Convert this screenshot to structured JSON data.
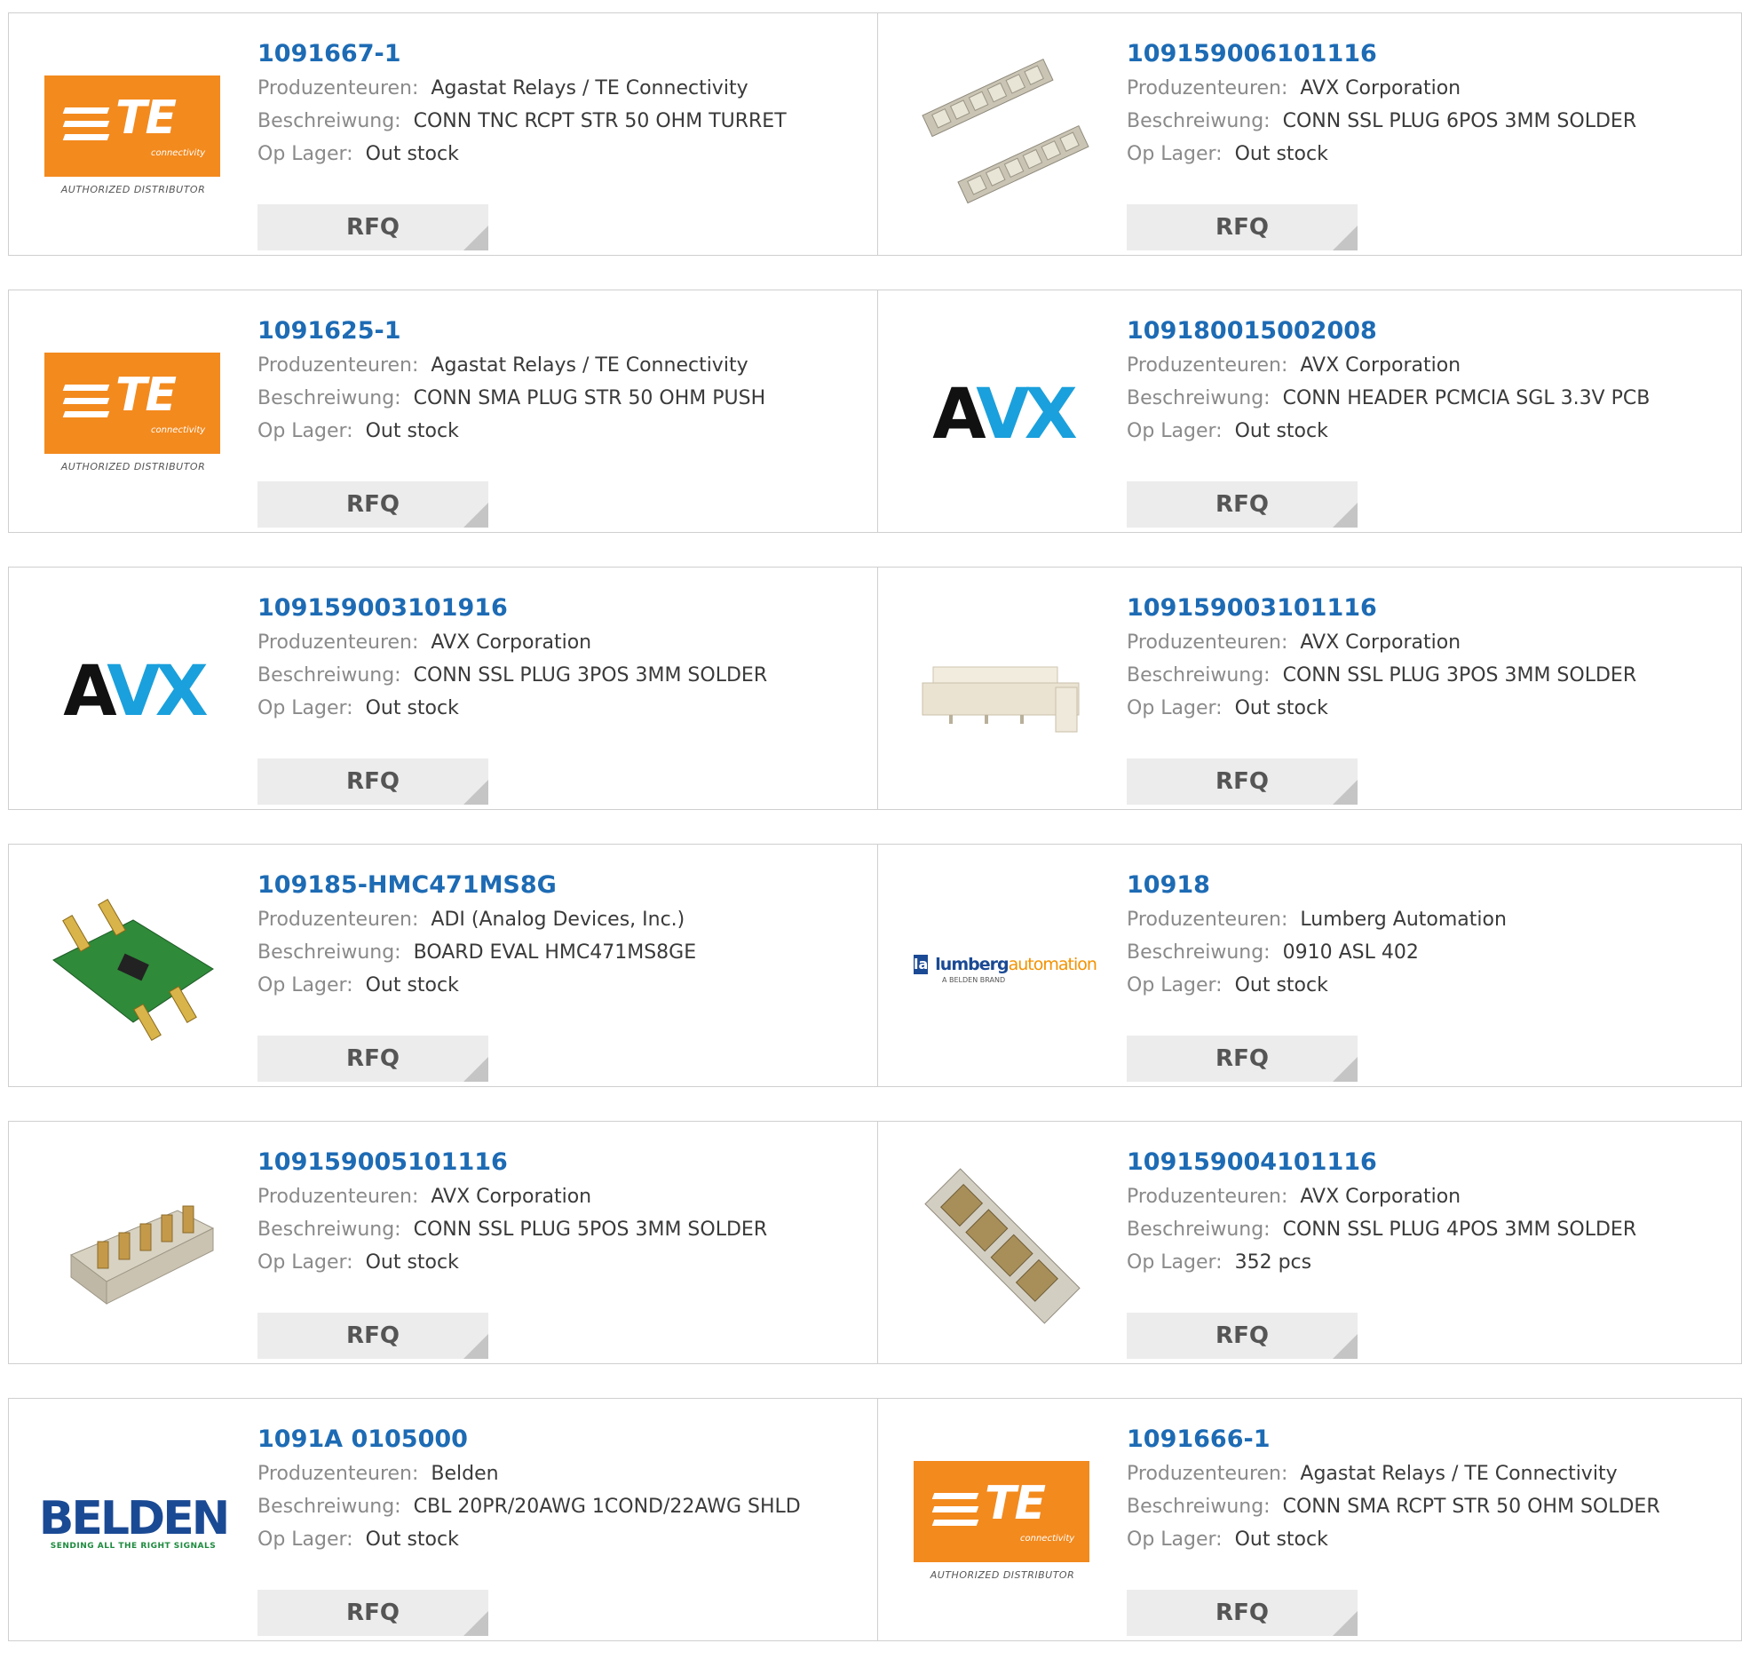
{
  "labels": {
    "manufacturer": "Produzenteuren:",
    "description": "Beschreiwung:",
    "stock": "Op Lager:",
    "rfq": "RFQ"
  },
  "logos": {
    "te_wordmark": "TE",
    "te_sub": "connectivity",
    "te_auth": "AUTHORIZED DISTRIBUTOR",
    "avx_a": "A",
    "avx_vx": "VX",
    "belden": "BELDEN",
    "belden_tagline": "SENDING ALL THE RIGHT SIGNALS",
    "lumberg_sq": "la",
    "lumberg_a": "lumberg",
    "lumberg_b": "automation",
    "lumberg_sub": "A BELDEN BRAND"
  },
  "colors": {
    "link": "#1d6bb4",
    "te_orange": "#f38a1e",
    "avx_blue": "#1aa0dc"
  },
  "products": [
    {
      "part": "1091667-1",
      "manufacturer": "Agastat Relays / TE Connectivity",
      "description": "CONN TNC RCPT STR 50 OHM TURRET",
      "stock": "Out stock",
      "image": "te-logo"
    },
    {
      "part": "109159006101116",
      "manufacturer": "AVX Corporation",
      "description": "CONN SSL PLUG 6POS 3MM SOLDER",
      "stock": "Out stock",
      "image": "connector-photo-6pos"
    },
    {
      "part": "1091625-1",
      "manufacturer": "Agastat Relays / TE Connectivity",
      "description": "CONN SMA PLUG STR 50 OHM PUSH",
      "stock": "Out stock",
      "image": "te-logo"
    },
    {
      "part": "109180015002008",
      "manufacturer": "AVX Corporation",
      "description": "CONN HEADER PCMCIA SGL 3.3V PCB",
      "stock": "Out stock",
      "image": "avx-logo"
    },
    {
      "part": "109159003101916",
      "manufacturer": "AVX Corporation",
      "description": "CONN SSL PLUG 3POS 3MM SOLDER",
      "stock": "Out stock",
      "image": "avx-logo"
    },
    {
      "part": "109159003101116",
      "manufacturer": "AVX Corporation",
      "description": "CONN SSL PLUG 3POS 3MM SOLDER",
      "stock": "Out stock",
      "image": "connector-photo-3pos"
    },
    {
      "part": "109185-HMC471MS8G",
      "manufacturer": "ADI (Analog Devices, Inc.)",
      "description": "BOARD EVAL HMC471MS8GE",
      "stock": "Out stock",
      "image": "eval-board-photo"
    },
    {
      "part": "10918",
      "manufacturer": "Lumberg Automation",
      "description": "0910 ASL 402",
      "stock": "Out stock",
      "image": "lumberg-logo"
    },
    {
      "part": "109159005101116",
      "manufacturer": "AVX Corporation",
      "description": "CONN SSL PLUG 5POS 3MM SOLDER",
      "stock": "Out stock",
      "image": "connector-photo-5pos"
    },
    {
      "part": "109159004101116",
      "manufacturer": "AVX Corporation",
      "description": "CONN SSL PLUG 4POS 3MM SOLDER",
      "stock": "352 pcs",
      "image": "connector-photo-4pos"
    },
    {
      "part": "1091A 0105000",
      "manufacturer": "Belden",
      "description": "CBL 20PR/20AWG 1COND/22AWG SHLD",
      "stock": "Out stock",
      "image": "belden-logo"
    },
    {
      "part": "1091666-1",
      "manufacturer": "Agastat Relays / TE Connectivity",
      "description": "CONN SMA RCPT STR 50 OHM SOLDER",
      "stock": "Out stock",
      "image": "te-logo"
    }
  ]
}
